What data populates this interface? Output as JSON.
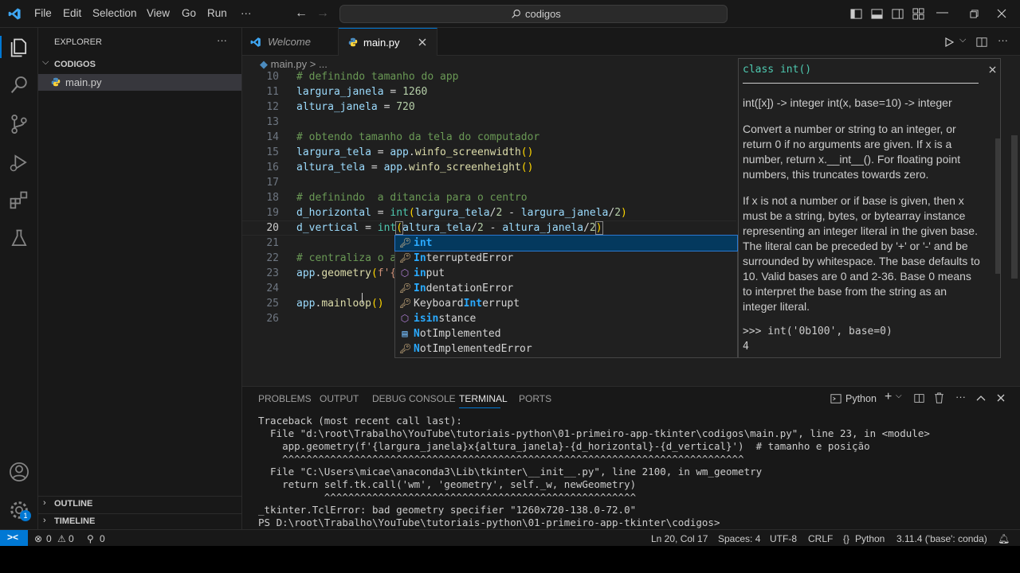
{
  "menu": {
    "file": "File",
    "edit": "Edit",
    "selection": "Selection",
    "view": "View",
    "go": "Go",
    "run": "Run",
    "more": "···"
  },
  "search": {
    "text": "codigos"
  },
  "explorer": {
    "title": "EXPLORER",
    "more": "···",
    "folder": "CODIGOS",
    "file": "main.py",
    "outline": "OUTLINE",
    "timeline": "TIMELINE"
  },
  "tabs": {
    "welcome": "Welcome",
    "main": "main.py"
  },
  "breadcrumb": {
    "file": "main.py",
    "sep": ">",
    "rest": "..."
  },
  "lines": [
    "10",
    "11",
    "12",
    "13",
    "14",
    "15",
    "16",
    "17",
    "18",
    "19",
    "20",
    "21",
    "22",
    "23",
    "24",
    "25",
    "26"
  ],
  "code": {
    "l10": "# definindo tamanho do app",
    "l11a": "largura_janela",
    "l11b": " = ",
    "l11c": "1260",
    "l12a": "altura_janela",
    "l12b": " = ",
    "l12c": "720",
    "l14": "# obtendo tamanho da tela do computador",
    "l15a": "largura_tela",
    "l15b": " = ",
    "l15c": "app",
    "l15d": ".",
    "l15e": "winfo_screenwidth",
    "l15f": "()",
    "l16a": "altura_tela",
    "l16b": " = ",
    "l16c": "app",
    "l16d": ".",
    "l16e": "winfo_screenheight",
    "l16f": "()",
    "l18": "# definindo  a ditancia para o centro",
    "l19a": "d_horizontal",
    "l19b": " = ",
    "l19c": "int",
    "l19d": "(",
    "l19e": "largura_tela",
    "l19f": "/",
    "l19g": "2",
    "l19h": " - ",
    "l19i": "largura_janela",
    "l19j": "/",
    "l19k": "2",
    "l19l": ")",
    "l20a": "d_vertical",
    "l20b": " = ",
    "l20c": "int",
    "l20d": "(",
    "l20e": "altura_tela",
    "l20f": "/",
    "l20g": "2",
    "l20h": " - ",
    "l20i": "altura_janela",
    "l20j": "/",
    "l20k": "2",
    "l20l": ")",
    "l22": "# centraliza o a",
    "l23a": "app",
    "l23b": ".",
    "l23c": "geometry",
    "l23d": "(",
    "l23e": "f'{",
    "l25a": "app",
    "l25b": ".",
    "l25c": "mainloop",
    "l25d": "()"
  },
  "suggestions": [
    {
      "icon": "key-icon",
      "pre": "",
      "hl": "int",
      "post": "",
      "selected": true
    },
    {
      "icon": "key-icon",
      "pre": "",
      "hl": "In",
      "post": "terruptedError",
      "selected": false
    },
    {
      "icon": "cube-icon",
      "pre": "",
      "hl": "in",
      "post": "put",
      "selected": false
    },
    {
      "icon": "key-icon",
      "pre": "",
      "hl": "In",
      "post": "dentationError",
      "selected": false
    },
    {
      "icon": "key-icon",
      "pre": "Keyboard",
      "hl": "Int",
      "post": "errupt",
      "selected": false
    },
    {
      "icon": "cube-icon",
      "pre": "",
      "hl": "isin",
      "post": "stance",
      "selected": false
    },
    {
      "icon": "enum-icon",
      "pre": "",
      "hl": "N",
      "post": "otImplemented",
      "selected": false
    },
    {
      "icon": "key-icon",
      "pre": "",
      "hl": "N",
      "post": "otImplementedError",
      "selected": false
    }
  ],
  "doc": {
    "header": "class int()",
    "sig": "int([x]) -> integer int(x, base=10) -> integer",
    "p1": "Convert a number or string to an integer, or return 0 if no arguments are given. If x is a number, return x.__int__(). For floating point numbers, this truncates towards zero.",
    "p2": "If x is not a number or if base is given, then x must be a string, bytes, or bytearray instance representing an integer literal in the given base. The literal can be preceded by '+' or '-' and be surrounded by whitespace. The base defaults to 10. Valid bases are 0 and 2-36. Base 0 means to interpret the base from the string as an integer literal.",
    "ex1": ">>> int('0b100', base=0)",
    "ex2": "4"
  },
  "panel": {
    "problems": "PROBLEMS",
    "output": "OUTPUT",
    "debug": "DEBUG CONSOLE",
    "terminal": "TERMINAL",
    "ports": "PORTS",
    "shell": "Python"
  },
  "terminal": [
    "Traceback (most recent call last):",
    "  File \"d:\\root\\Trabalho\\YouTube\\tutoriais-python\\01-primeiro-app-tkinter\\codigos\\main.py\", line 23, in <module>",
    "    app.geometry(f'{largura_janela}x{altura_janela}-{d_horizontal}-{d_vertical}')  # tamanho e posição",
    "    ^^^^^^^^^^^^^^^^^^^^^^^^^^^^^^^^^^^^^^^^^^^^^^^^^^^^^^^^^^^^^^^^^^^^^^^^^^^^^",
    "  File \"C:\\Users\\micae\\anaconda3\\Lib\\tkinter\\__init__.py\", line 2100, in wm_geometry",
    "    return self.tk.call('wm', 'geometry', self._w, newGeometry)",
    "           ^^^^^^^^^^^^^^^^^^^^^^^^^^^^^^^^^^^^^^^^^^^^^^^^^^^^",
    "_tkinter.TclError: bad geometry specifier \"1260x720-138.0-72.0\"",
    "PS D:\\root\\Trabalho\\YouTube\\tutoriais-python\\01-primeiro-app-tkinter\\codigos>"
  ],
  "status": {
    "remote": "><",
    "errors": "0",
    "warnings": "0",
    "ports": "0",
    "position": "Ln 20, Col 17",
    "spaces": "Spaces: 4",
    "encoding": "UTF-8",
    "eol": "CRLF",
    "language": "Python",
    "interpreter": "3.11.4 ('base': conda)",
    "badge": "1"
  }
}
